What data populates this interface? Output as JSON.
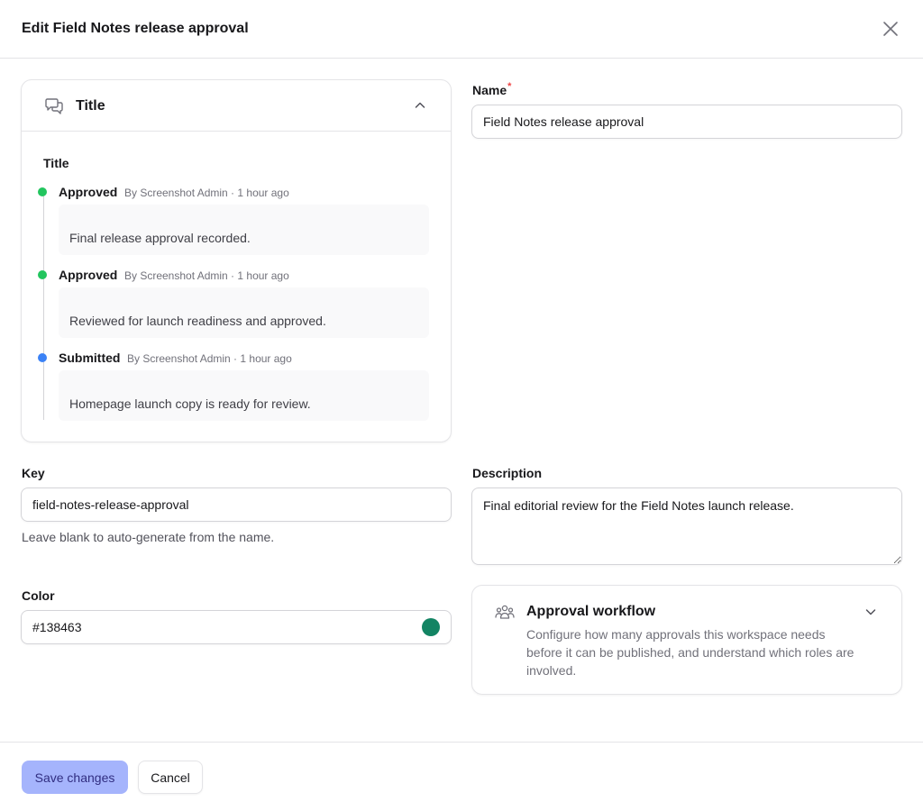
{
  "dialog": {
    "title": "Edit Field Notes release approval",
    "close_icon": "close-icon"
  },
  "history": {
    "card_title": "Title",
    "section_label": "Title",
    "header_icon": "chat-bubbles-icon",
    "toggle_icon": "chevron-up-icon",
    "entries": [
      {
        "status": "Approved",
        "meta": "By Screenshot Admin · 1 hour ago",
        "text": "Final release approval recorded.",
        "dot_color": "#22c55e"
      },
      {
        "status": "Approved",
        "meta": "By Screenshot Admin · 1 hour ago",
        "text": "Reviewed for launch readiness and approved.",
        "dot_color": "#22c55e"
      },
      {
        "status": "Submitted",
        "meta": "By Screenshot Admin · 1 hour ago",
        "text": "Homepage launch copy is ready for review.",
        "dot_color": "#3b82f6"
      }
    ]
  },
  "form": {
    "name": {
      "label": "Name",
      "required_mark": "*",
      "value": "Field Notes release approval"
    },
    "key": {
      "label": "Key",
      "value": "field-notes-release-approval",
      "hint": "Leave blank to auto-generate from the name."
    },
    "description": {
      "label": "Description",
      "value": "Final editorial review for the Field Notes launch release."
    },
    "color": {
      "label": "Color",
      "value": "#138463",
      "swatch": "#138463"
    }
  },
  "workflow": {
    "title": "Approval workflow",
    "description": "Configure how many approvals this workspace needs before it can be published, and understand which roles are involved.",
    "icon": "users-group-icon",
    "toggle_icon": "chevron-down-icon"
  },
  "footer": {
    "save_label": "Save changes",
    "cancel_label": "Cancel"
  },
  "colors": {
    "primary_button_bg": "#a5b4fc",
    "primary_button_text": "#312e81",
    "required": "#ef4444"
  }
}
